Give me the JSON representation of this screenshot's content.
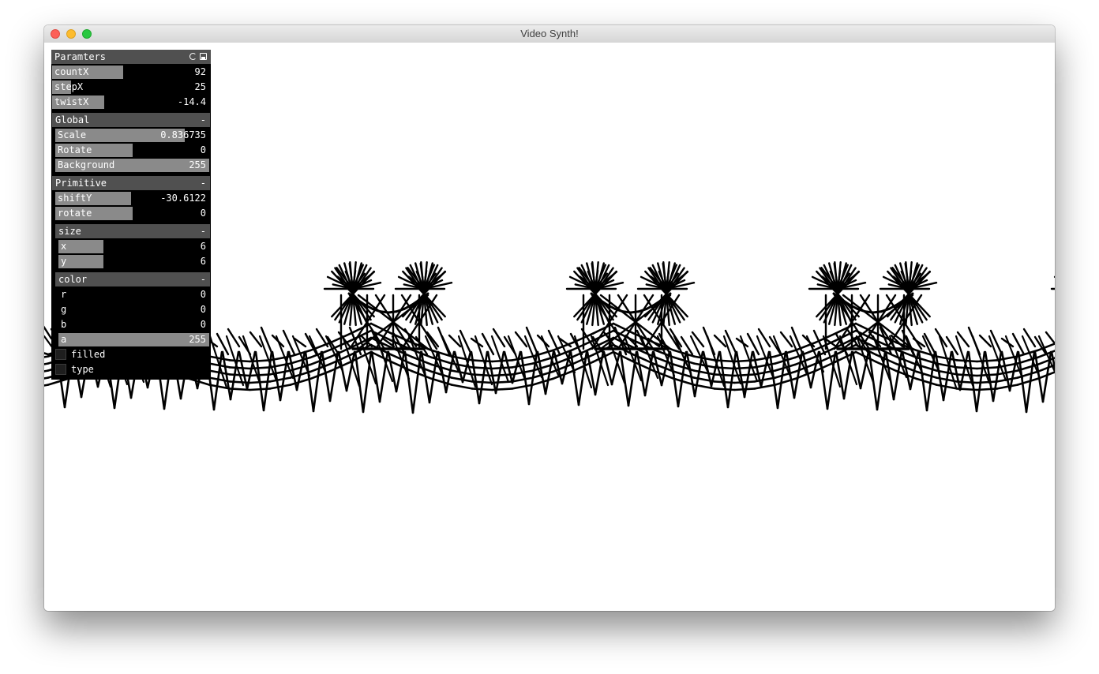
{
  "window": {
    "title": "Video Synth!"
  },
  "canvas": {
    "background": "#ffffff",
    "stroke_color": "#000000"
  },
  "gui": {
    "panel": {
      "title": "Paramters",
      "icons": [
        "reload-icon",
        "save-icon"
      ],
      "params": [
        {
          "label": "countX",
          "value": "92",
          "fill": 0.45
        },
        {
          "label": "stepX",
          "value": "25",
          "fill": 0.12
        },
        {
          "label": "twistX",
          "value": "-14.4",
          "fill": 0.33
        }
      ]
    },
    "global": {
      "title": "Global",
      "collapse": "-",
      "params": [
        {
          "label": "Scale",
          "value": "0.836735",
          "fill": 0.84
        },
        {
          "label": "Rotate",
          "value": "0",
          "fill": 0.5
        },
        {
          "label": "Background",
          "value": "255",
          "fill": 1.0
        }
      ]
    },
    "primitive": {
      "title": "Primitive",
      "collapse": "-",
      "params": [
        {
          "label": "shiftY",
          "value": "-30.6122",
          "fill": 0.49
        },
        {
          "label": "rotate",
          "value": "0",
          "fill": 0.5
        }
      ],
      "size": {
        "title": "size",
        "collapse": "-",
        "params": [
          {
            "label": "x",
            "value": "6",
            "fill": 0.3
          },
          {
            "label": "y",
            "value": "6",
            "fill": 0.3
          }
        ]
      },
      "color": {
        "title": "color",
        "collapse": "-",
        "params": [
          {
            "label": "r",
            "value": "0",
            "fill": 0.0
          },
          {
            "label": "g",
            "value": "0",
            "fill": 0.0
          },
          {
            "label": "b",
            "value": "0",
            "fill": 0.0
          },
          {
            "label": "a",
            "value": "255",
            "fill": 1.0
          }
        ]
      },
      "toggles": [
        {
          "label": "filled",
          "checked": false
        },
        {
          "label": "type",
          "checked": false
        }
      ]
    }
  }
}
